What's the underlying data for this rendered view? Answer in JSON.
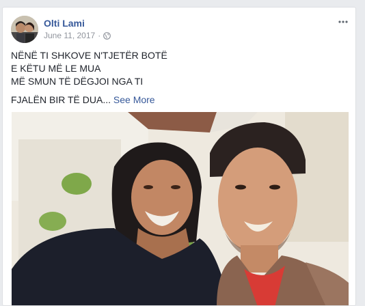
{
  "post": {
    "author": "Olti Lami",
    "date": "June 11, 2017",
    "separator": "·",
    "privacy_icon": "globe-icon",
    "more_icon": "more-options-icon",
    "text_lines": [
      "NËNË TI SHKOVE N'TJETËR BOTË",
      "E KËTU MË LE MUA",
      "MË SMUN TË DËGJOI NGA TI"
    ],
    "last_line": "FJALËN BIR TË DUA...",
    "see_more": "See More"
  },
  "colors": {
    "link": "#365899",
    "text": "#1d2129",
    "meta": "#90949c",
    "background": "#e9ebee"
  }
}
